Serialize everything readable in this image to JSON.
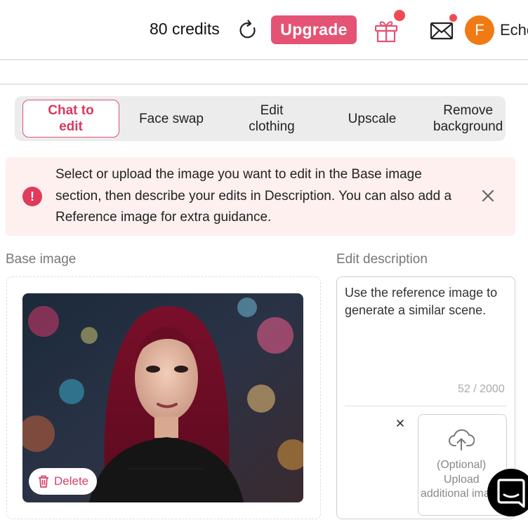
{
  "header": {
    "credits": "80 credits",
    "upgrade_label": "Upgrade",
    "avatar_initial": "F",
    "username": "Echo",
    "refresh_icon": "refresh-icon",
    "gift_icon": "gift-icon",
    "mail_icon": "mail-icon",
    "notification_color": "#ef4b55"
  },
  "tabs": [
    {
      "label": "Chat to\nedit",
      "active": true
    },
    {
      "label": "Face swap",
      "active": false
    },
    {
      "label": "Edit\nclothing",
      "active": false
    },
    {
      "label": "Upscale",
      "active": false
    },
    {
      "label": "Remove\nbackground",
      "active": false
    }
  ],
  "info": {
    "text": "Select or upload the image you want to edit in the Base image section, then describe your edits in Description. You can also add a Reference image for extra guidance.",
    "icon": "info-icon",
    "close_icon": "close-icon"
  },
  "base_image": {
    "label": "Base image",
    "delete_label": "Delete"
  },
  "description": {
    "label": "Edit description",
    "value": "Use the reference image to generate a similar scene.",
    "counter": "52 / 2000"
  },
  "reference": {
    "upload_line1": "(Optional)",
    "upload_line2": "Upload",
    "upload_line3": "additional image"
  },
  "colors": {
    "accent": "#e55374",
    "accent_text": "#d83a5e",
    "avatar": "#f07a14",
    "banner_bg": "#fdf0ee"
  }
}
